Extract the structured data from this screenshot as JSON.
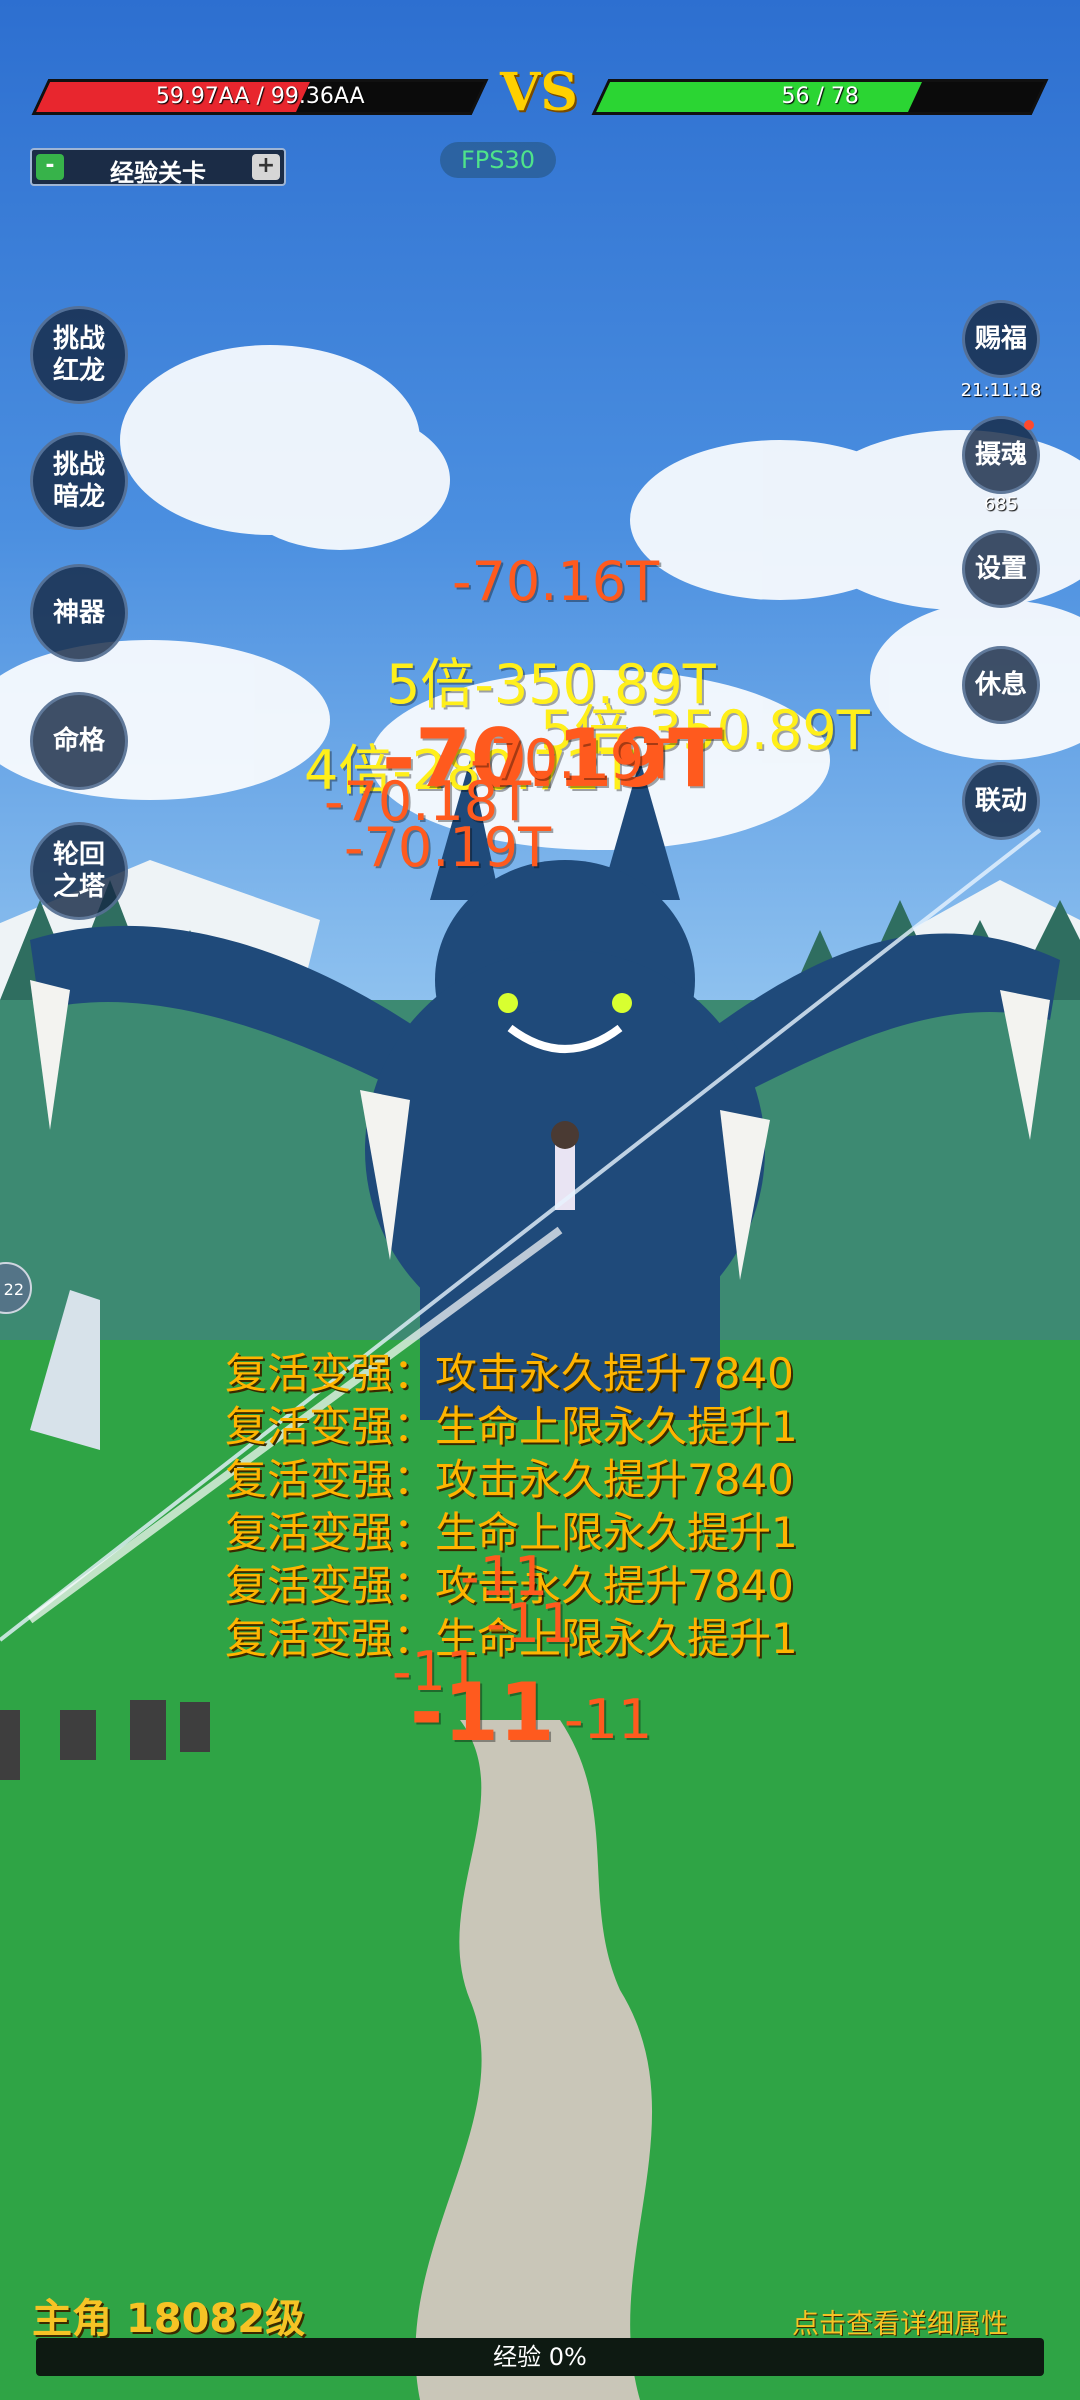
{
  "topbar": {
    "player_hp": {
      "text": "59.97AA / 99.36AA",
      "fill": 0.6,
      "color": "#e8262e"
    },
    "vs": "VS",
    "enemy_hp": {
      "text": "56 / 78",
      "fill": 0.72,
      "color": "#2bd533"
    }
  },
  "stage": {
    "minus": "-",
    "label": "经验关卡",
    "plus": "+"
  },
  "fps": "FPS30",
  "left_menu": [
    "挑战\n红龙",
    "挑战\n暗龙",
    "神器",
    "命格",
    "轮回\n之塔"
  ],
  "right_menu": [
    {
      "label": "赐福",
      "sub": "21:11:18"
    },
    {
      "label": "摄魂",
      "sub": "685"
    },
    {
      "label": "设置"
    },
    {
      "label": "休息"
    },
    {
      "label": "联动"
    }
  ],
  "edge_button": "22",
  "damage_numbers": [
    "-70.16T",
    "5倍-350.89T",
    "5倍-350.89T",
    "4倍-280.72T",
    "-70.19T",
    "-70.19T",
    "-70.18T",
    "-70.19T",
    "-11",
    "-11",
    "-11",
    "-11",
    "-11"
  ],
  "buffs": [
    "复活变强：攻击永久提升7840",
    "复活变强：生命上限永久提升1",
    "复活变强：攻击永久提升7840",
    "复活变强：生命上限永久提升1",
    "复活变强：攻击永久提升7840",
    "复活变强：生命上限永久提升1"
  ],
  "footer": {
    "level": "主角 18082级",
    "detail": "点击查看详细属性",
    "exp": "经验 0%",
    "exp_fill": 0
  }
}
